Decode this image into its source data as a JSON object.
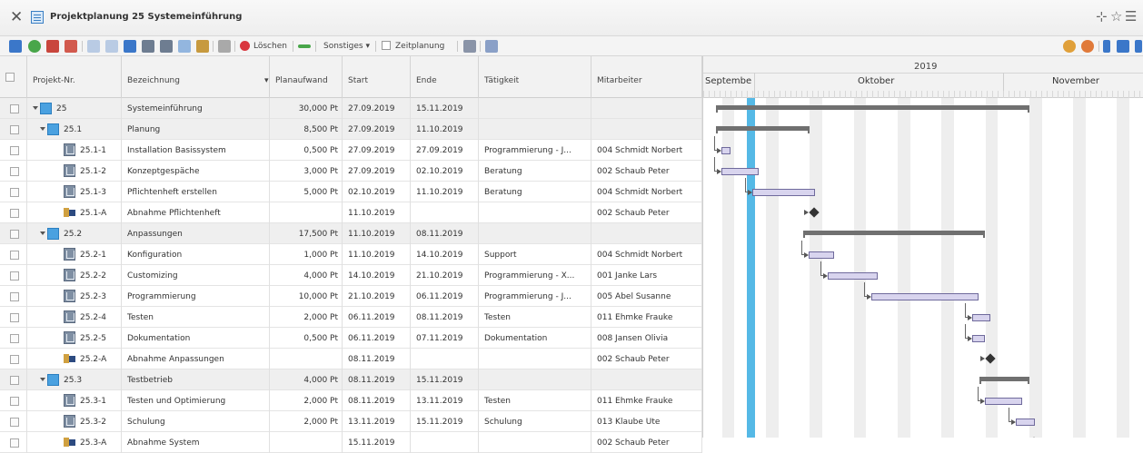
{
  "window": {
    "title": "Projektplanung 25 Systemeinführung"
  },
  "toolbar": {
    "delete_label": "Löschen",
    "misc_label": "Sonstiges ▾",
    "timeplan_label": "Zeitplanung"
  },
  "columns": [
    "Projekt-Nr.",
    "Bezeichnung",
    "Planaufwand",
    "Start",
    "Ende",
    "Tätigkeit",
    "Mitarbeiter"
  ],
  "gantt": {
    "year": "2019",
    "months": [
      "Septembe",
      "Oktober",
      "November"
    ]
  },
  "rows": [
    {
      "nr": "25",
      "name": "Systemeinführung",
      "effort": "30,000 Pt",
      "start": "27.09.2019",
      "end": "15.11.2019",
      "activity": "",
      "employee": "",
      "kind": "summary",
      "level": 0
    },
    {
      "nr": "25.1",
      "name": "Planung",
      "effort": "8,500 Pt",
      "start": "27.09.2019",
      "end": "11.10.2019",
      "activity": "",
      "employee": "",
      "kind": "summary",
      "level": 1
    },
    {
      "nr": "25.1-1",
      "name": "Installation Basissystem",
      "effort": "0,500 Pt",
      "start": "27.09.2019",
      "end": "27.09.2019",
      "activity": "Programmierung - J...",
      "employee": "004 Schmidt Norbert",
      "kind": "task",
      "level": 2
    },
    {
      "nr": "25.1-2",
      "name": "Konzeptgespäche",
      "effort": "3,000 Pt",
      "start": "27.09.2019",
      "end": "02.10.2019",
      "activity": "Beratung",
      "employee": "002 Schaub Peter",
      "kind": "task",
      "level": 2
    },
    {
      "nr": "25.1-3",
      "name": "Pflichtenheft erstellen",
      "effort": "5,000 Pt",
      "start": "02.10.2019",
      "end": "11.10.2019",
      "activity": "Beratung",
      "employee": "004 Schmidt Norbert",
      "kind": "task",
      "level": 2
    },
    {
      "nr": "25.1-A",
      "name": "Abnahme Pflichtenheft",
      "effort": "",
      "start": "11.10.2019",
      "end": "",
      "activity": "",
      "employee": "002 Schaub Peter",
      "kind": "milestone",
      "level": 2
    },
    {
      "nr": "25.2",
      "name": "Anpassungen",
      "effort": "17,500 Pt",
      "start": "11.10.2019",
      "end": "08.11.2019",
      "activity": "",
      "employee": "",
      "kind": "summary",
      "level": 1
    },
    {
      "nr": "25.2-1",
      "name": "Konfiguration",
      "effort": "1,000 Pt",
      "start": "11.10.2019",
      "end": "14.10.2019",
      "activity": "Support",
      "employee": "004 Schmidt Norbert",
      "kind": "task",
      "level": 2
    },
    {
      "nr": "25.2-2",
      "name": "Customizing",
      "effort": "4,000 Pt",
      "start": "14.10.2019",
      "end": "21.10.2019",
      "activity": "Programmierung - X...",
      "employee": "001 Janke Lars",
      "kind": "task",
      "level": 2
    },
    {
      "nr": "25.2-3",
      "name": "Programmierung",
      "effort": "10,000 Pt",
      "start": "21.10.2019",
      "end": "06.11.2019",
      "activity": "Programmierung - J...",
      "employee": "005 Abel Susanne",
      "kind": "task",
      "level": 2
    },
    {
      "nr": "25.2-4",
      "name": "Testen",
      "effort": "2,000 Pt",
      "start": "06.11.2019",
      "end": "08.11.2019",
      "activity": "Testen",
      "employee": "011 Ehmke Frauke",
      "kind": "task",
      "level": 2
    },
    {
      "nr": "25.2-5",
      "name": "Dokumentation",
      "effort": "0,500 Pt",
      "start": "06.11.2019",
      "end": "07.11.2019",
      "activity": "Dokumentation",
      "employee": "008 Jansen Olivia",
      "kind": "task",
      "level": 2
    },
    {
      "nr": "25.2-A",
      "name": "Abnahme Anpassungen",
      "effort": "",
      "start": "08.11.2019",
      "end": "",
      "activity": "",
      "employee": "002 Schaub Peter",
      "kind": "milestone",
      "level": 2
    },
    {
      "nr": "25.3",
      "name": "Testbetrieb",
      "effort": "4,000 Pt",
      "start": "08.11.2019",
      "end": "15.11.2019",
      "activity": "",
      "employee": "",
      "kind": "summary",
      "level": 1
    },
    {
      "nr": "25.3-1",
      "name": "Testen und Optimierung",
      "effort": "2,000 Pt",
      "start": "08.11.2019",
      "end": "13.11.2019",
      "activity": "Testen",
      "employee": "011 Ehmke Frauke",
      "kind": "task",
      "level": 2
    },
    {
      "nr": "25.3-2",
      "name": "Schulung",
      "effort": "2,000 Pt",
      "start": "13.11.2019",
      "end": "15.11.2019",
      "activity": "Schulung",
      "employee": "013 Klaube Ute",
      "kind": "task",
      "level": 2
    },
    {
      "nr": "25.3-A",
      "name": "Abnahme System",
      "effort": "",
      "start": "15.11.2019",
      "end": "",
      "activity": "",
      "employee": "002 Schaub Peter",
      "kind": "milestone",
      "level": 2
    }
  ]
}
